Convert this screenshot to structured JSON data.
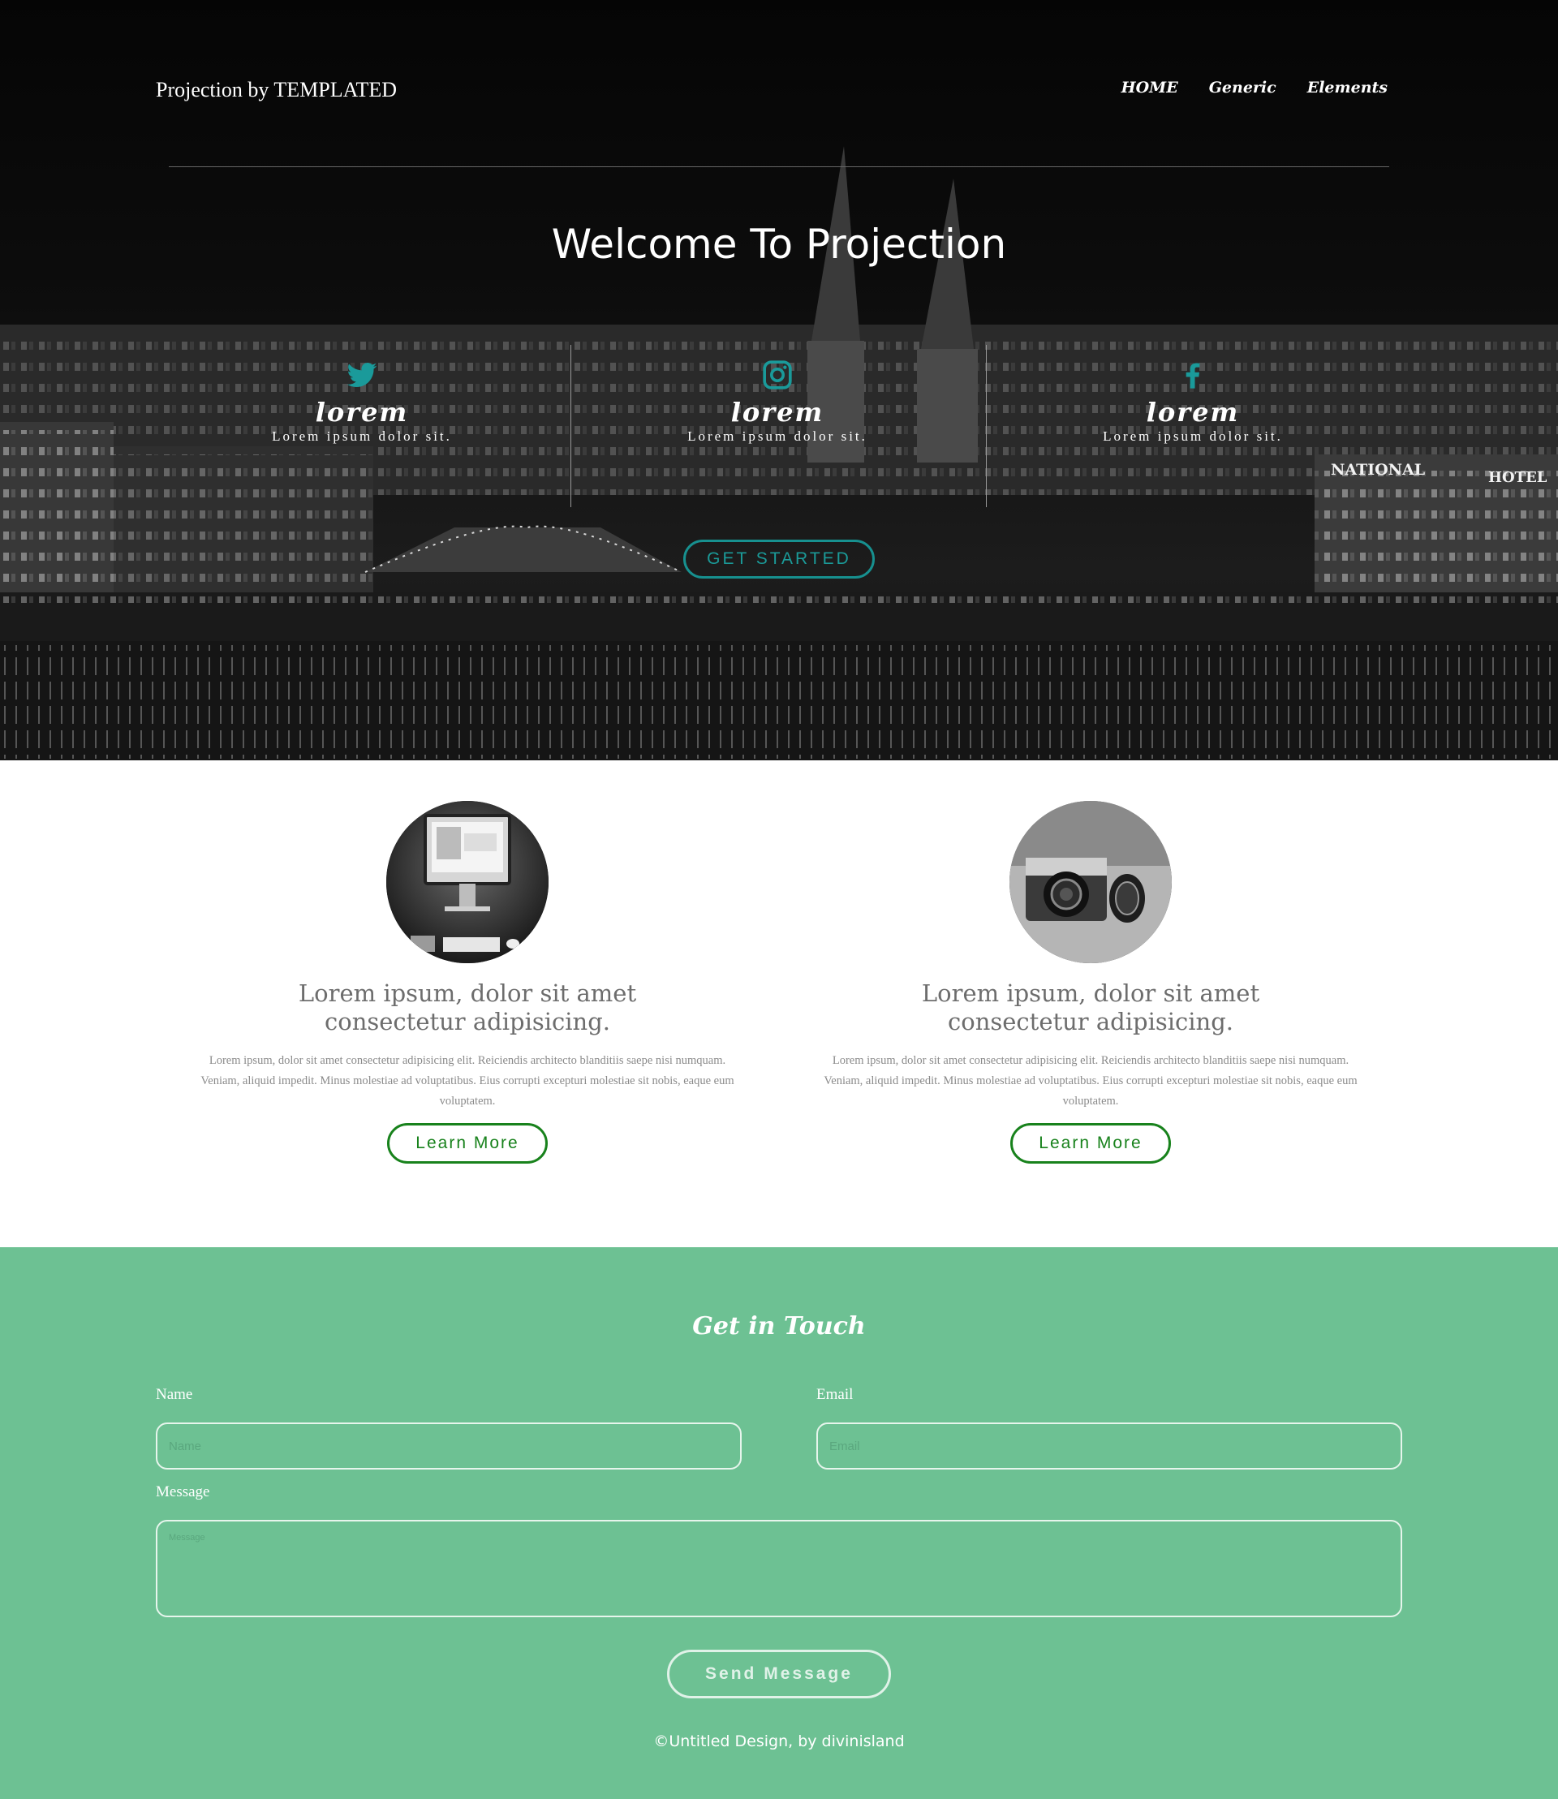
{
  "header": {
    "brand": "Projection by TEMPLATED",
    "nav": [
      "HOME",
      "Generic",
      "Elements"
    ]
  },
  "hero": {
    "title": "Welcome To Projection",
    "features": [
      {
        "icon": "twitter-icon",
        "title": "lorem",
        "text": "Lorem ipsum dolor sit."
      },
      {
        "icon": "instagram-icon",
        "title": "lorem",
        "text": "Lorem ipsum dolor sit."
      },
      {
        "icon": "facebook-icon",
        "title": "lorem",
        "text": "Lorem ipsum dolor sit."
      }
    ],
    "cta": "GET STARTED",
    "signs": [
      "NATIONAL",
      "HOTEL"
    ]
  },
  "cards": [
    {
      "image": "computer-image",
      "title": "Lorem ipsum, dolor sit amet consectetur adipisicing.",
      "text": "Lorem ipsum, dolor sit amet consectetur adipisicing elit. Reiciendis architecto blanditiis saepe nisi numquam. Veniam, aliquid impedit. Minus molestiae ad voluptatibus. Eius corrupti excepturi molestiae sit nobis, eaque eum voluptatem.",
      "button": "Learn More"
    },
    {
      "image": "camera-image",
      "title": "Lorem ipsum, dolor sit amet consectetur adipisicing.",
      "text": "Lorem ipsum, dolor sit amet consectetur adipisicing elit. Reiciendis architecto blanditiis saepe nisi numquam. Veniam, aliquid impedit. Minus molestiae ad voluptatibus. Eius corrupti excepturi molestiae sit nobis, eaque eum voluptatem.",
      "button": "Learn More"
    }
  ],
  "contact": {
    "title": "Get in Touch",
    "name_label": "Name",
    "name_placeholder": "Name",
    "email_label": "Email",
    "email_placeholder": "Email",
    "message_label": "Message",
    "message_placeholder": "Message",
    "send": "Send Message"
  },
  "footer": "©Untitled Design, by divinisland",
  "colors": {
    "accent_teal": "#17908f",
    "button_green": "#18821c",
    "contact_bg": "#6dc193"
  }
}
